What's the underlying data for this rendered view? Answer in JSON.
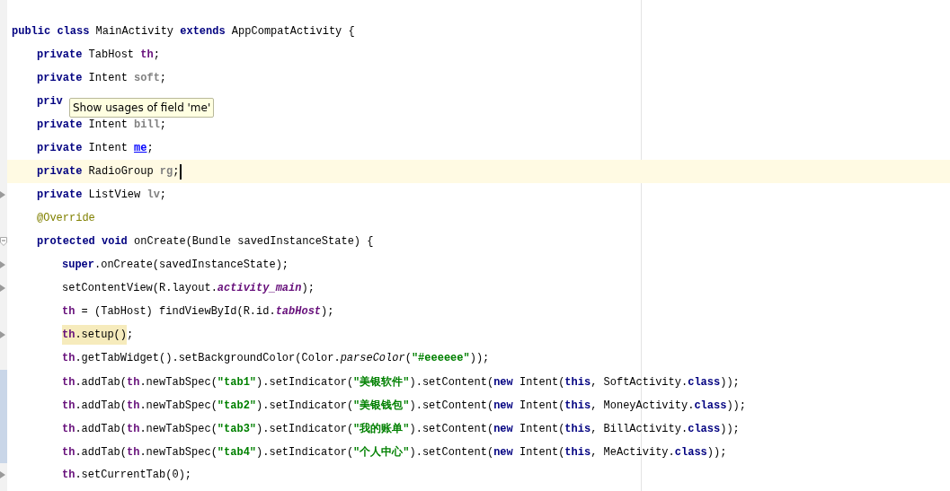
{
  "editor": {
    "lines": [
      {
        "marker": false,
        "changed": false,
        "foldable": false,
        "current": false,
        "tokens": [
          {
            "kind": "keyword",
            "text": "public class"
          },
          {
            "kind": "plain",
            "text": " MainActivity "
          },
          {
            "kind": "keyword",
            "text": "extends"
          },
          {
            "kind": "plain",
            "text": " AppCompatActivity {"
          }
        ],
        "children": [
          {
            "marker": false,
            "changed": false,
            "foldable": false,
            "current": false,
            "tokens": [
              {
                "kind": "keyword",
                "text": "private"
              },
              {
                "kind": "plain",
                "text": " TabHost "
              },
              {
                "kind": "field",
                "text": "th"
              },
              {
                "kind": "plain",
                "text": ";"
              }
            ]
          },
          {
            "marker": false,
            "changed": false,
            "foldable": false,
            "current": false,
            "tokens": [
              {
                "kind": "keyword",
                "text": "private"
              },
              {
                "kind": "plain",
                "text": " Intent "
              },
              {
                "kind": "unused",
                "text": "soft"
              },
              {
                "kind": "plain",
                "text": ";"
              }
            ]
          },
          {
            "marker": false,
            "changed": false,
            "foldable": false,
            "current": false,
            "tokens": [
              {
                "kind": "keyword",
                "text": "priv"
              }
            ]
          },
          {
            "marker": false,
            "changed": false,
            "foldable": false,
            "current": false,
            "tokens": [
              {
                "kind": "keyword",
                "text": "private"
              },
              {
                "kind": "plain",
                "text": " Intent "
              },
              {
                "kind": "unused",
                "text": "bill"
              },
              {
                "kind": "plain",
                "text": ";"
              }
            ]
          },
          {
            "marker": false,
            "changed": false,
            "foldable": false,
            "current": false,
            "tokens": [
              {
                "kind": "keyword",
                "text": "private"
              },
              {
                "kind": "plain",
                "text": " Intent "
              },
              {
                "kind": "link",
                "text": "me"
              },
              {
                "kind": "plain",
                "text": ";"
              }
            ]
          },
          {
            "marker": false,
            "changed": false,
            "foldable": false,
            "current": true,
            "tokens": [
              {
                "kind": "keyword",
                "text": "private"
              },
              {
                "kind": "plain",
                "text": " RadioGroup "
              },
              {
                "kind": "unused",
                "text": "rg"
              },
              {
                "kind": "plain",
                "text": ";"
              }
            ]
          },
          {
            "marker": true,
            "changed": false,
            "foldable": false,
            "current": false,
            "tokens": [
              {
                "kind": "keyword",
                "text": "private"
              },
              {
                "kind": "plain",
                "text": " ListView "
              },
              {
                "kind": "unused",
                "text": "lv"
              },
              {
                "kind": "plain",
                "text": ";"
              }
            ]
          },
          {
            "marker": false,
            "changed": false,
            "foldable": false,
            "current": false,
            "tokens": [
              {
                "kind": "annotation",
                "text": "@Override"
              }
            ]
          },
          {
            "marker": false,
            "changed": false,
            "foldable": true,
            "current": false,
            "tokens": [
              {
                "kind": "keyword",
                "text": "protected void"
              },
              {
                "kind": "plain",
                "text": " onCreate(Bundle savedInstanceState) {"
              }
            ],
            "children": [
              {
                "marker": true,
                "changed": false,
                "foldable": false,
                "current": false,
                "tokens": [
                  {
                    "kind": "keyword",
                    "text": "super"
                  },
                  {
                    "kind": "plain",
                    "text": ".onCreate(savedInstanceState);"
                  }
                ]
              },
              {
                "marker": true,
                "changed": false,
                "foldable": false,
                "current": false,
                "tokens": [
                  {
                    "kind": "plain",
                    "text": "setContentView(R.layout."
                  },
                  {
                    "kind": "static",
                    "text": "activity_main"
                  },
                  {
                    "kind": "plain",
                    "text": ");"
                  }
                ]
              },
              {
                "marker": false,
                "changed": false,
                "foldable": false,
                "current": false,
                "tokens": [
                  {
                    "kind": "field",
                    "text": "th"
                  },
                  {
                    "kind": "plain",
                    "text": " = (TabHost) findViewById(R.id."
                  },
                  {
                    "kind": "static",
                    "text": "tabHost"
                  },
                  {
                    "kind": "plain",
                    "text": ");"
                  }
                ]
              },
              {
                "marker": true,
                "changed": false,
                "foldable": false,
                "current": false,
                "tokens": [
                  {
                    "kind": "fieldmark",
                    "text": "th"
                  },
                  {
                    "kind": "plainmark",
                    "text": ".setup()"
                  },
                  {
                    "kind": "plain",
                    "text": ";"
                  }
                ]
              },
              {
                "marker": false,
                "changed": false,
                "foldable": false,
                "current": false,
                "tokens": [
                  {
                    "kind": "field",
                    "text": "th"
                  },
                  {
                    "kind": "plain",
                    "text": ".getTabWidget().setBackgroundColor(Color."
                  },
                  {
                    "kind": "italic",
                    "text": "parseColor"
                  },
                  {
                    "kind": "plain",
                    "text": "("
                  },
                  {
                    "kind": "string",
                    "text": "\"#eeeeee\""
                  },
                  {
                    "kind": "plain",
                    "text": "));"
                  }
                ]
              },
              {
                "marker": false,
                "changed": true,
                "foldable": false,
                "current": false,
                "tokens": [
                  {
                    "kind": "field",
                    "text": "th"
                  },
                  {
                    "kind": "plain",
                    "text": ".addTab("
                  },
                  {
                    "kind": "field",
                    "text": "th"
                  },
                  {
                    "kind": "plain",
                    "text": ".newTabSpec("
                  },
                  {
                    "kind": "string",
                    "text": "\"tab1\""
                  },
                  {
                    "kind": "plain",
                    "text": ").setIndicator("
                  },
                  {
                    "kind": "string",
                    "text": "\"美银软件\""
                  },
                  {
                    "kind": "plain",
                    "text": ").setContent("
                  },
                  {
                    "kind": "keyword",
                    "text": "new"
                  },
                  {
                    "kind": "plain",
                    "text": " Intent("
                  },
                  {
                    "kind": "keyword",
                    "text": "this"
                  },
                  {
                    "kind": "plain",
                    "text": ", SoftActivity."
                  },
                  {
                    "kind": "keyword",
                    "text": "class"
                  },
                  {
                    "kind": "plain",
                    "text": "));"
                  }
                ]
              },
              {
                "marker": false,
                "changed": true,
                "foldable": false,
                "current": false,
                "tokens": [
                  {
                    "kind": "field",
                    "text": "th"
                  },
                  {
                    "kind": "plain",
                    "text": ".addTab("
                  },
                  {
                    "kind": "field",
                    "text": "th"
                  },
                  {
                    "kind": "plain",
                    "text": ".newTabSpec("
                  },
                  {
                    "kind": "string",
                    "text": "\"tab2\""
                  },
                  {
                    "kind": "plain",
                    "text": ").setIndicator("
                  },
                  {
                    "kind": "string",
                    "text": "\"美银钱包\""
                  },
                  {
                    "kind": "plain",
                    "text": ").setContent("
                  },
                  {
                    "kind": "keyword",
                    "text": "new"
                  },
                  {
                    "kind": "plain",
                    "text": " Intent("
                  },
                  {
                    "kind": "keyword",
                    "text": "this"
                  },
                  {
                    "kind": "plain",
                    "text": ", MoneyActivity."
                  },
                  {
                    "kind": "keyword",
                    "text": "class"
                  },
                  {
                    "kind": "plain",
                    "text": "));"
                  }
                ]
              },
              {
                "marker": false,
                "changed": true,
                "foldable": false,
                "current": false,
                "tokens": [
                  {
                    "kind": "field",
                    "text": "th"
                  },
                  {
                    "kind": "plain",
                    "text": ".addTab("
                  },
                  {
                    "kind": "field",
                    "text": "th"
                  },
                  {
                    "kind": "plain",
                    "text": ".newTabSpec("
                  },
                  {
                    "kind": "string",
                    "text": "\"tab3\""
                  },
                  {
                    "kind": "plain",
                    "text": ").setIndicator("
                  },
                  {
                    "kind": "string",
                    "text": "\"我的账单\""
                  },
                  {
                    "kind": "plain",
                    "text": ").setContent("
                  },
                  {
                    "kind": "keyword",
                    "text": "new"
                  },
                  {
                    "kind": "plain",
                    "text": " Intent("
                  },
                  {
                    "kind": "keyword",
                    "text": "this"
                  },
                  {
                    "kind": "plain",
                    "text": ", BillActivity."
                  },
                  {
                    "kind": "keyword",
                    "text": "class"
                  },
                  {
                    "kind": "plain",
                    "text": "));"
                  }
                ]
              },
              {
                "marker": false,
                "changed": true,
                "foldable": false,
                "current": false,
                "tokens": [
                  {
                    "kind": "field",
                    "text": "th"
                  },
                  {
                    "kind": "plain",
                    "text": ".addTab("
                  },
                  {
                    "kind": "field",
                    "text": "th"
                  },
                  {
                    "kind": "plain",
                    "text": ".newTabSpec("
                  },
                  {
                    "kind": "string",
                    "text": "\"tab4\""
                  },
                  {
                    "kind": "plain",
                    "text": ").setIndicator("
                  },
                  {
                    "kind": "string",
                    "text": "\"个人中心\""
                  },
                  {
                    "kind": "plain",
                    "text": ").setContent("
                  },
                  {
                    "kind": "keyword",
                    "text": "new"
                  },
                  {
                    "kind": "plain",
                    "text": " Intent("
                  },
                  {
                    "kind": "keyword",
                    "text": "this"
                  },
                  {
                    "kind": "plain",
                    "text": ", MeActivity."
                  },
                  {
                    "kind": "keyword",
                    "text": "class"
                  },
                  {
                    "kind": "plain",
                    "text": "));"
                  }
                ]
              },
              {
                "marker": true,
                "changed": false,
                "foldable": false,
                "current": false,
                "tokens": [
                  {
                    "kind": "field",
                    "text": "th"
                  },
                  {
                    "kind": "plain",
                    "text": ".setCurrentTab(0);"
                  }
                ]
              }
            ]
          }
        ]
      }
    ],
    "tooltip": {
      "text": "Show usages of field 'me'"
    }
  }
}
